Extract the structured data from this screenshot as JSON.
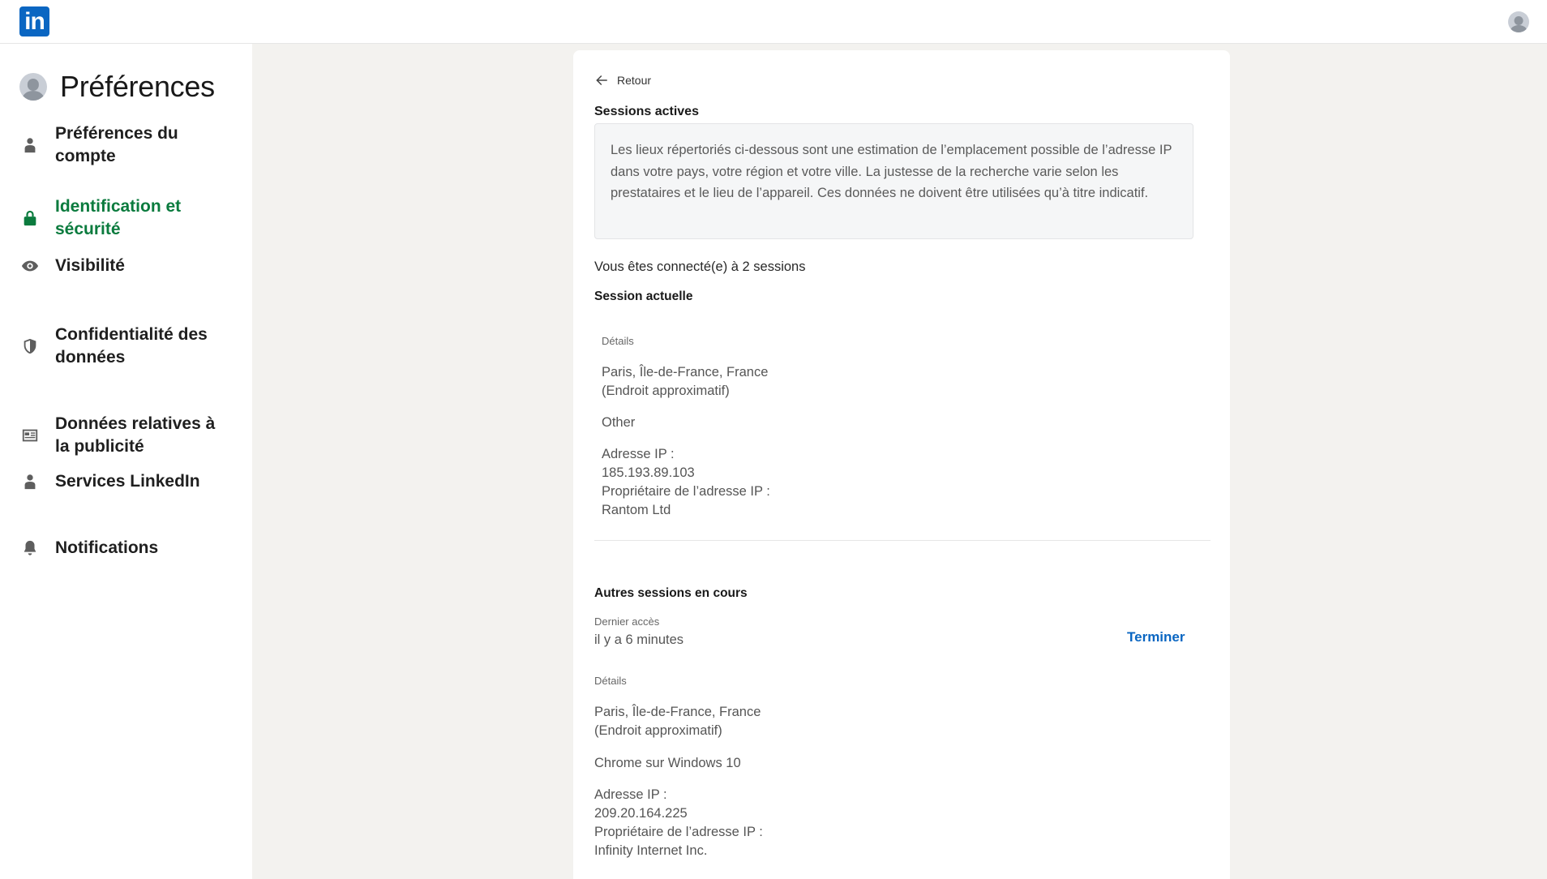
{
  "topbar": {
    "logo_text": "in",
    "logo_icon": "linkedin-logo",
    "avatar_icon": "user-avatar"
  },
  "sidebar": {
    "title": "Préférences",
    "items": [
      {
        "label": "Préférences du compte",
        "icon": "person-icon",
        "active": false
      },
      {
        "label": "Identification et sécurité",
        "icon": "lock-icon",
        "active": true
      },
      {
        "label": "Visibilité",
        "icon": "eye-icon",
        "active": false
      },
      {
        "label": "Confidentialité des données",
        "icon": "shield-icon",
        "active": false
      },
      {
        "label": "Données relatives à la publicité",
        "icon": "newspaper-icon",
        "active": false
      },
      {
        "label": "Services LinkedIn",
        "icon": "person-icon",
        "active": false
      },
      {
        "label": "Notifications",
        "icon": "bell-icon",
        "active": false
      }
    ]
  },
  "main": {
    "back_label": "Retour",
    "title": "Sessions actives",
    "info": "Les lieux répertoriés ci-dessous sont une estimation de l’emplacement possible de l’adresse IP dans votre pays, votre région et votre ville. La justesse de la recherche varie selon les prestataires et le lieu de l’appareil. Ces données ne doivent être utilisées qu’à titre indicatif.",
    "connected_text": "Vous êtes connecté(e) à 2 sessions",
    "current": {
      "heading": "Session actuelle",
      "details_label": "Détails",
      "location": "Paris, Île-de-France, France",
      "location_note": "(Endroit approximatif)",
      "device": "Other",
      "ip_label": "Adresse IP :",
      "ip": "185.193.89.103",
      "owner_label": "Propriétaire de l’adresse IP :",
      "owner": "Rantom Ltd"
    },
    "other": {
      "heading": "Autres sessions en cours",
      "last_access_label": "Dernier accès",
      "last_access": "il y a 6 minutes",
      "terminate_label": "Terminer",
      "details_label": "Détails",
      "location": "Paris, Île-de-France, France",
      "location_note": "(Endroit approximatif)",
      "device": "Chrome sur Windows 10",
      "ip_label": "Adresse IP :",
      "ip": "209.20.164.225",
      "owner_label": "Propriétaire de l’adresse IP :",
      "owner": "Infinity Internet Inc."
    }
  },
  "colors": {
    "brand": "#0a66c2",
    "active_nav": "#0b7b3e",
    "page_bg": "#f3f2ef"
  }
}
